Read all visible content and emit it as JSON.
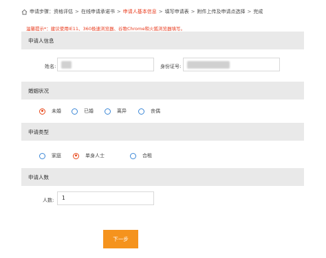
{
  "breadcrumb": {
    "prefix": "申请步骤：",
    "steps": [
      "资格评估",
      "在线申请承诺书",
      "申请人基本信息",
      "填写申请表",
      "附件上传及申请点选择",
      "完成"
    ],
    "separator": ">"
  },
  "tip": "温馨提示*：建议使用IE11、360极速浏览器、谷歌Chrome和火狐浏览器填写。",
  "applicant_info": {
    "title": "申请人信息",
    "name_label": "姓名:",
    "id_label": "身份证号:"
  },
  "marital": {
    "title": "婚姻状况",
    "options": [
      "未婚",
      "已婚",
      "离异",
      "丧偶"
    ],
    "selected": "未婚"
  },
  "apply_type": {
    "title": "申请类型",
    "options": [
      "家庭",
      "单身人士",
      "合租"
    ],
    "selected": "单身人士"
  },
  "apply_count": {
    "title": "申请人数",
    "count_label": "人数:",
    "count_value": "1"
  },
  "next_button": "下一步",
  "colors": {
    "accent": "#e8381a",
    "button": "#f5931d",
    "radio": "#3a86d6",
    "section_bg": "#e9e9e9"
  }
}
